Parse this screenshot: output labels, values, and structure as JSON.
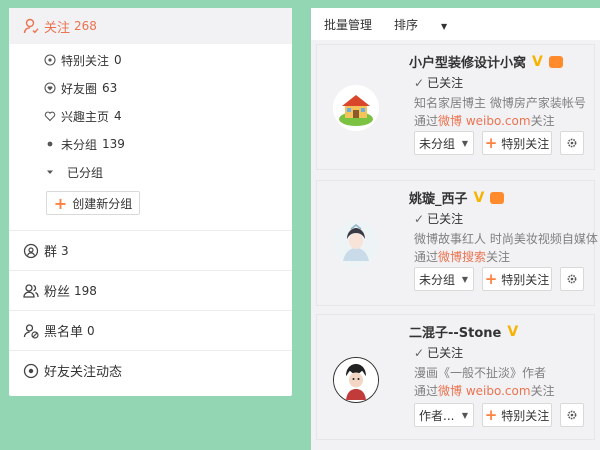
{
  "nav": {
    "following": {
      "label": "关注",
      "count": "268"
    },
    "sub": [
      {
        "label": "特别关注",
        "count": "0",
        "icon": "star-circle-icon"
      },
      {
        "label": "好友圈",
        "count": "63",
        "icon": "heart-circle-icon"
      },
      {
        "label": "兴趣主页",
        "count": "4",
        "icon": "heart-outline-icon"
      },
      {
        "label": "未分组",
        "count": "139",
        "icon": "dot-icon"
      },
      {
        "label": "已分组",
        "count": "",
        "icon": "caret-down-icon"
      }
    ],
    "create_group": "创建新分组",
    "groups": [
      {
        "label": "群",
        "count": "3",
        "icon": "group-chat-icon"
      },
      {
        "label": "粉丝",
        "count": "198",
        "icon": "fans-icon"
      },
      {
        "label": "黑名单",
        "count": "0",
        "icon": "blacklist-icon"
      },
      {
        "label": "好友关注动态",
        "count": "",
        "icon": "friend-activity-icon"
      }
    ]
  },
  "toolbar": {
    "batch": "批量管理",
    "sort": "排序"
  },
  "accent_color": "#eb7350",
  "users": [
    {
      "name": "小户型装修设计小窝",
      "followed": "已关注",
      "desc": "知名家居博主 微博房产家装帐号",
      "via_prefix": "通过",
      "via_source": "微博 weibo.com",
      "via_suffix": "关注",
      "group": "未分组",
      "special": "特别关注"
    },
    {
      "name": "姚璇_西子",
      "followed": "已关注",
      "desc": "微博故事红人 时尚美妆视频自媒体",
      "via_prefix": "通过",
      "via_source": "微博搜索",
      "via_suffix": "关注",
      "group": "未分组",
      "special": "特别关注"
    },
    {
      "name": "二混子--Stone",
      "followed": "已关注",
      "desc": "漫画《一般不扯淡》作者",
      "via_prefix": "通过",
      "via_source": "微博 weibo.com",
      "via_suffix": "关注",
      "group": "作者...",
      "special": "特别关注"
    }
  ]
}
